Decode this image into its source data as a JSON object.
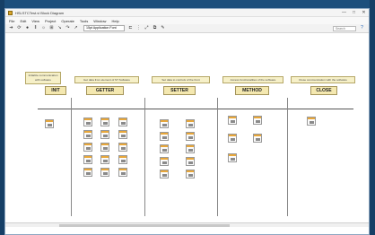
{
  "window": {
    "title": "HSLSTCTest.vi Block Diagram"
  },
  "menu": [
    "File",
    "Edit",
    "View",
    "Project",
    "Operate",
    "Tools",
    "Window",
    "Help"
  ],
  "toolbar": {
    "font": "15pt Application Font",
    "search_placeholder": "Search"
  },
  "cases": [
    {
      "label": "INIT",
      "description": "Initialize communication with software"
    },
    {
      "label": "GETTER",
      "description": "Get data from element of ST Software"
    },
    {
      "label": "SETTER",
      "description": "Set data to controls of the front"
    },
    {
      "label": "METHOD",
      "description": "Access functionalities of the software"
    },
    {
      "label": "CLOSE",
      "description": "Close communication with the software"
    }
  ]
}
